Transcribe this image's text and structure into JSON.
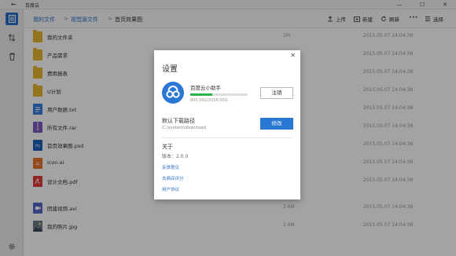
{
  "window": {
    "title": "百度云",
    "controls": [
      "—",
      "☐",
      "✕"
    ]
  },
  "breadcrumb": {
    "items": [
      "我的文件",
      "视觉源文件",
      "首页效果图"
    ],
    "separator": ">"
  },
  "toolbar": {
    "upload_label": "上传",
    "new_label": "新建",
    "refresh_label": "刷新",
    "more_label": "•••",
    "select_label": "选择"
  },
  "files": [
    {
      "name": "我的文件夹",
      "size": "2M",
      "date": "2015.05.07  14:04:38",
      "icon": "folder-icon"
    },
    {
      "name": "产品需求",
      "size": "",
      "date": "2015.05.07  14:04:38",
      "icon": "folder-icon"
    },
    {
      "name": "费用报表",
      "size": "",
      "date": "2015.05.07  14:04:38",
      "icon": "folder-icon"
    },
    {
      "name": "U计划",
      "size": "",
      "date": "2015.05.07  14:04:38",
      "icon": "folder-icon"
    },
    {
      "name": "用户数据.txt",
      "size": "",
      "date": "2015.05.07  14:04:38",
      "icon": "txt-file-icon"
    },
    {
      "name": "所有文件.rar",
      "size": "",
      "date": "2015.05.07  14:04:38",
      "icon": "rar-file-icon"
    },
    {
      "name": "首页效果图.psd",
      "size": "",
      "date": "2015.05.07  14:04:38",
      "icon": "psd-file-icon"
    },
    {
      "name": "icon.ai",
      "size": "",
      "date": "2015.05.07  14:04:38",
      "icon": "ai-file-icon"
    },
    {
      "name": "设计文档.pdf",
      "size": "",
      "date": "2015.05.07  14:04:38",
      "icon": "pdf-file-icon"
    },
    {
      "name": "团建视频.avi",
      "size": "2.6M",
      "date": "2015.05.07  14:04:38",
      "icon": "video-file-icon"
    },
    {
      "name": "我的照片.jpg",
      "size": "2.6M",
      "date": "2015.05.07  14:04:38",
      "icon": "image-file-icon"
    }
  ],
  "dialog": {
    "title": "设置",
    "close": "✕",
    "username": "百度云小助手",
    "quota": "800.56G/2056.00G",
    "usage_fraction": 0.39,
    "logout_label": "注销",
    "download_dir_label": "默认下载路径",
    "download_dir_path": "C:\\system\\download",
    "modify_label": "修改",
    "about_label": "关于",
    "version": "版本：2.0.0",
    "links": [
      "反馈意见",
      "去商店评分",
      "用户协议"
    ]
  },
  "colors": {
    "accent": "#2a78d4",
    "folder": "#e8b830",
    "progress": "#2ab54a"
  }
}
